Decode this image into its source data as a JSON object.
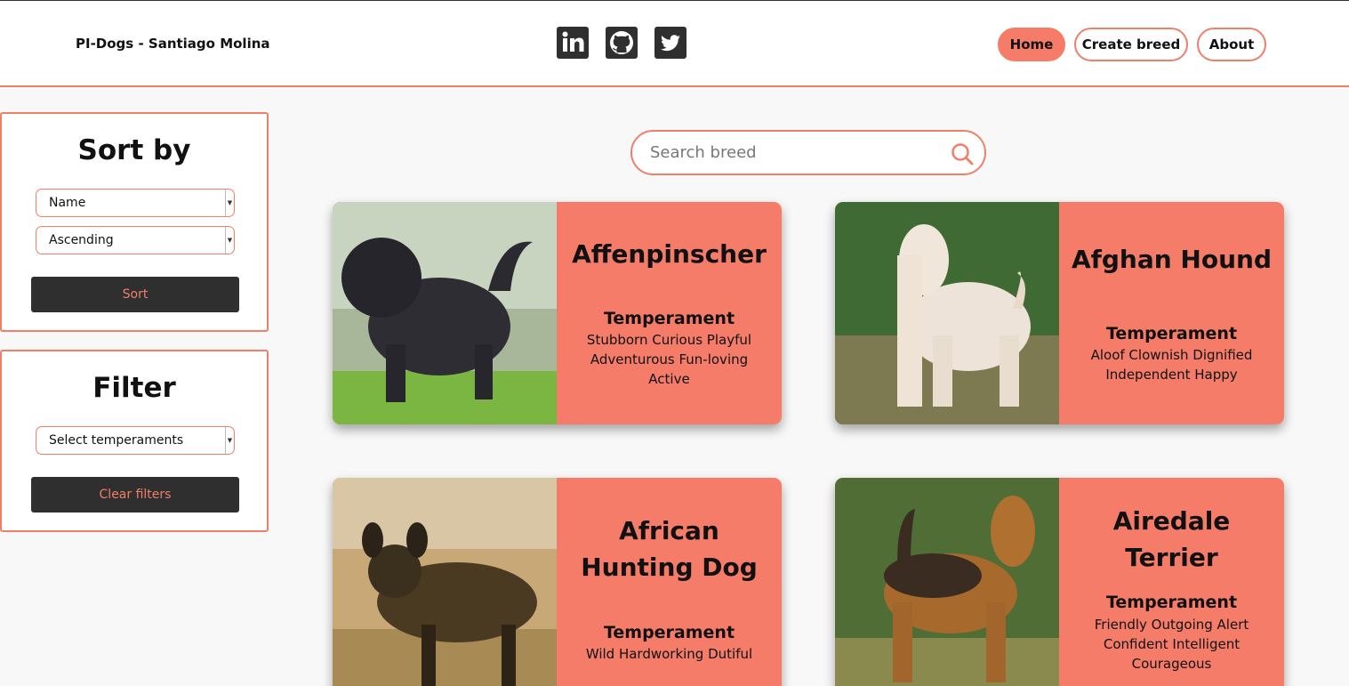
{
  "header": {
    "brand": "PI-Dogs - Santiago Molina",
    "socials": [
      {
        "icon": "linkedin-icon"
      },
      {
        "icon": "github-icon"
      },
      {
        "icon": "twitter-icon"
      }
    ],
    "nav": {
      "home": "Home",
      "create": "Create breed",
      "about": "About"
    }
  },
  "sort_panel": {
    "title": "Sort by",
    "field_select": "Name",
    "order_select": "Ascending",
    "button": "Sort"
  },
  "filter_panel": {
    "title": "Filter",
    "temperament_select": "Select temperaments",
    "button": "Clear filters"
  },
  "search": {
    "placeholder": "Search breed"
  },
  "cards": [
    {
      "name": "Affenpinscher",
      "temperament_title": "Temperament",
      "temperaments": "Stubborn  Curious  Playful  Adventurous  Fun-loving  Active"
    },
    {
      "name": "Afghan Hound",
      "temperament_title": "Temperament",
      "temperaments": "Aloof  Clownish  Dignified  Independent  Happy"
    },
    {
      "name": "African Hunting Dog",
      "temperament_title": "Temperament",
      "temperaments": "Wild  Hardworking  Dutiful"
    },
    {
      "name": "Airedale Terrier",
      "temperament_title": "Temperament",
      "temperaments": "Friendly  Outgoing  Alert  Confident  Intelligent  Courageous"
    }
  ],
  "colors": {
    "accent": "#f47c68",
    "dark": "#2f2f2f"
  }
}
